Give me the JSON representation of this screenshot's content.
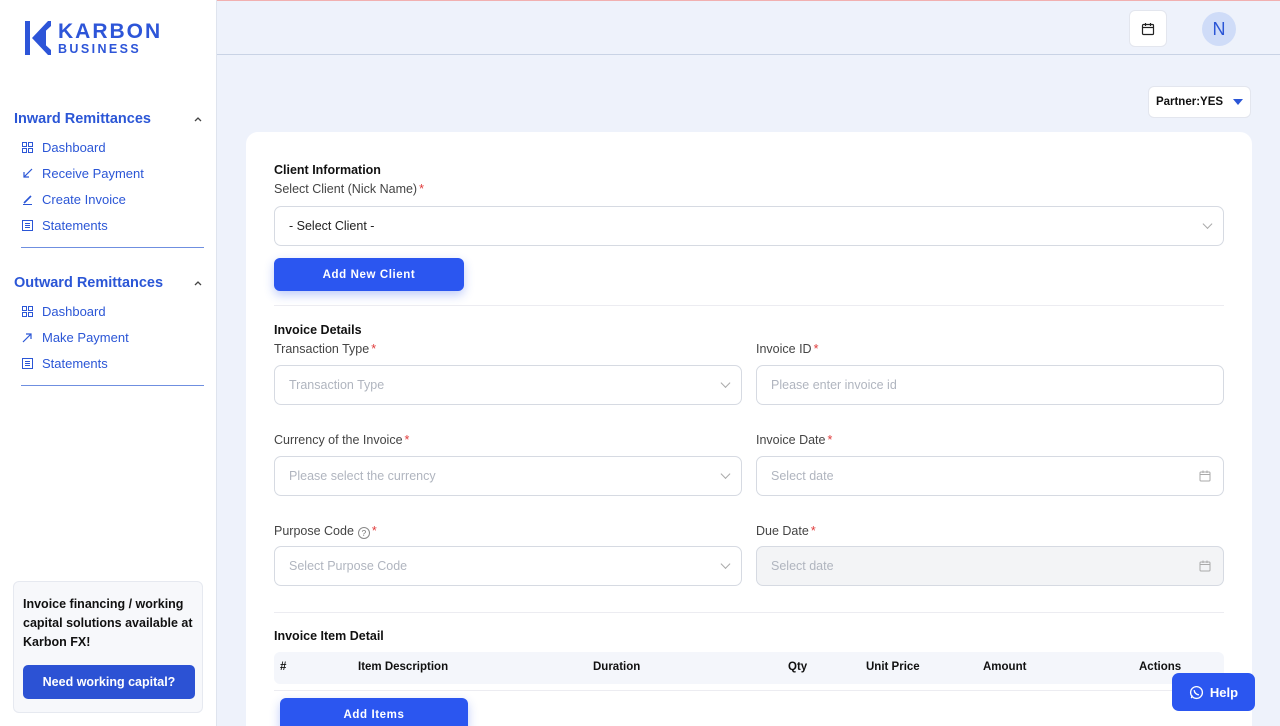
{
  "brand": {
    "name": "KARBON",
    "sub": "BUSINESS",
    "color": "#2d55d8"
  },
  "sidebar": {
    "inward": {
      "title": "Inward Remittances",
      "items": [
        {
          "label": "Dashboard",
          "icon": "grid-icon"
        },
        {
          "label": "Receive Payment",
          "icon": "arrow-down-left-icon"
        },
        {
          "label": "Create Invoice",
          "icon": "edit-invoice-icon"
        },
        {
          "label": "Statements",
          "icon": "document-list-icon"
        }
      ]
    },
    "outward": {
      "title": "Outward Remittances",
      "items": [
        {
          "label": "Dashboard",
          "icon": "grid-icon"
        },
        {
          "label": "Make Payment",
          "icon": "arrow-up-right-icon"
        },
        {
          "label": "Statements",
          "icon": "document-list-icon"
        }
      ]
    },
    "promo": {
      "text": "Invoice financing / working capital solutions available at Karbon FX!",
      "button": "Need working capital?"
    }
  },
  "topbar": {
    "avatar_initial": "N"
  },
  "partner": {
    "label": "Partner:YES"
  },
  "form": {
    "client_section": "Client Information",
    "client_label": "Select Client (Nick Name)",
    "client_value": "- Select Client -",
    "add_client": "Add New Client",
    "invoice_section": "Invoice Details",
    "transaction_type_label": "Transaction Type",
    "transaction_type_placeholder": "Transaction Type",
    "invoice_id_label": "Invoice ID",
    "invoice_id_placeholder": "Please enter invoice id",
    "currency_label": "Currency of the Invoice",
    "currency_placeholder": "Please select the currency",
    "invoice_date_label": "Invoice Date",
    "invoice_date_placeholder": "Select date",
    "purpose_label": "Purpose Code",
    "purpose_placeholder": "Select Purpose Code",
    "due_date_label": "Due Date",
    "due_date_placeholder": "Select date",
    "items_section": "Invoice Item Detail",
    "columns": [
      "#",
      "Item Description",
      "Duration",
      "Qty",
      "Unit Price",
      "Amount",
      "Actions"
    ],
    "add_items": "Add Items"
  },
  "help": {
    "label": "Help"
  },
  "colors": {
    "primary": "#2b56f0",
    "required": "#e03b3b"
  }
}
